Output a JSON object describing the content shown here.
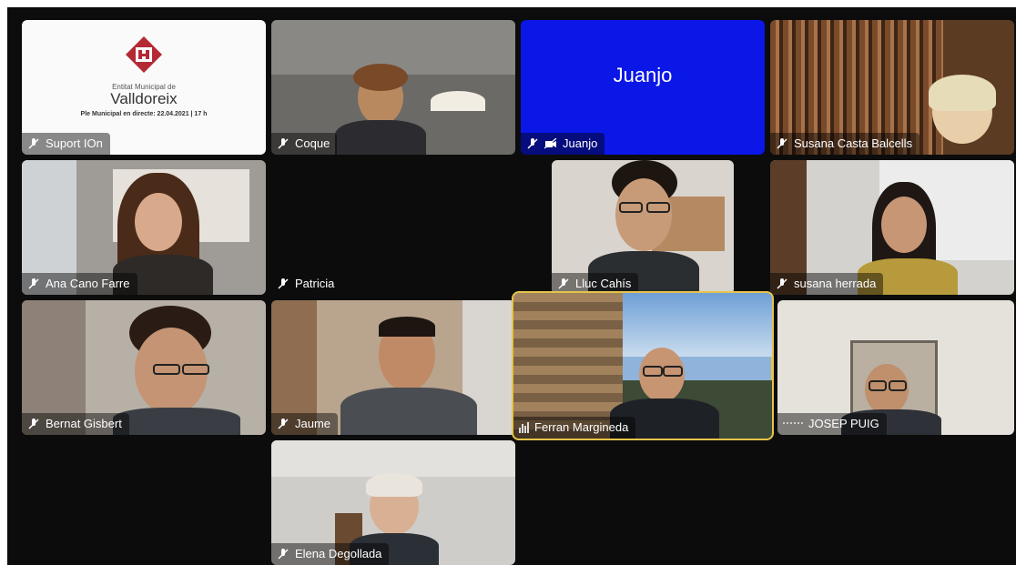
{
  "org": {
    "small": "Entitat Municipal de",
    "name": "Valldoreix",
    "subtitle": "Ple Municipal en directe: 22.04.2021 | 17 h"
  },
  "tiles": [
    {
      "name": "Suport IOn"
    },
    {
      "name": "Coque"
    },
    {
      "name": "Juanjo",
      "center_name": "Juanjo"
    },
    {
      "name": "Susana Casta Balcells"
    },
    {
      "name": "Ana  Cano Farre"
    },
    {
      "name": "Patricia"
    },
    {
      "name": "Lluc Cahís"
    },
    {
      "name": "susana herrada"
    },
    {
      "name": "Bernat Gisbert"
    },
    {
      "name": "Jaume"
    },
    {
      "name": "Ferran Margineda"
    },
    {
      "name": "JOSEP PUIG"
    },
    {
      "name": "Elena Degollada"
    }
  ],
  "colors": {
    "juanjo_bg": "#0a17e6",
    "active_border": "#e6c44a",
    "logo_red": "#b32a35"
  },
  "icons": [
    "mic-muted-icon",
    "camera-off-icon",
    "audio-bars-icon",
    "connection-dots-icon"
  ]
}
